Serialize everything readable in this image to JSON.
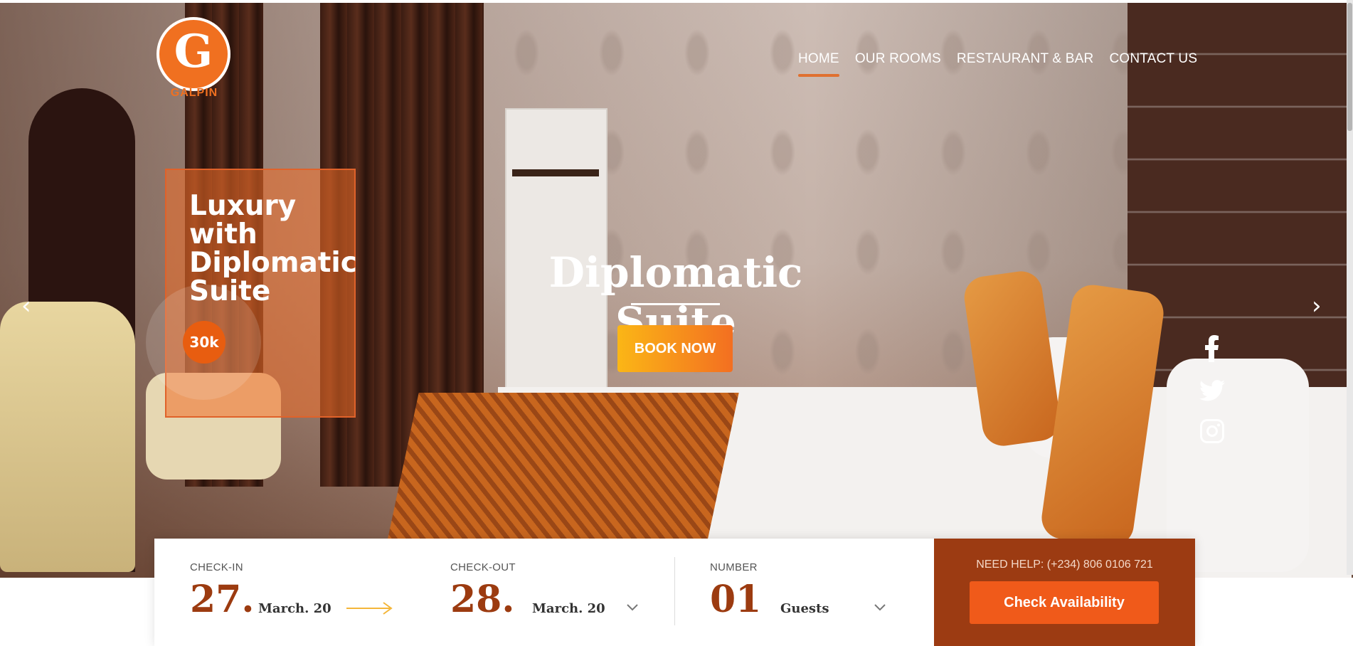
{
  "brand": {
    "logo_letter": "G",
    "logo_name": "GALPIN",
    "accent_color": "#f07020"
  },
  "nav": {
    "items": [
      {
        "label": "HOME",
        "active": true
      },
      {
        "label": "OUR ROOMS",
        "active": false
      },
      {
        "label": "RESTAURANT & BAR",
        "active": false
      },
      {
        "label": "CONTACT US",
        "active": false
      }
    ]
  },
  "promo": {
    "title": "Luxury with Diplomatic Suite",
    "price": "30k"
  },
  "hero": {
    "title": "Diplomatic Suite",
    "book_label": "BOOK NOW"
  },
  "carousel": {
    "prev_icon": "chevron-left-icon",
    "next_icon": "chevron-right-icon"
  },
  "social": [
    "facebook-icon",
    "twitter-icon",
    "instagram-icon"
  ],
  "booking": {
    "checkin_label": "CHECK-IN",
    "checkin_day": "27.",
    "checkin_month": "March. 20",
    "checkout_label": "CHECK-OUT",
    "checkout_day": "28.",
    "checkout_month": "March. 20",
    "number_label": "NUMBER",
    "number_value": "01",
    "number_unit": "Guests",
    "help_text": "NEED HELP: (+234) 806 0106 721",
    "check_label": "Check Availability"
  },
  "colors": {
    "cta_gradient_start": "#fbb616",
    "cta_gradient_end": "#f36f21",
    "panel": "#9c3b12",
    "button": "#f05a1a"
  }
}
